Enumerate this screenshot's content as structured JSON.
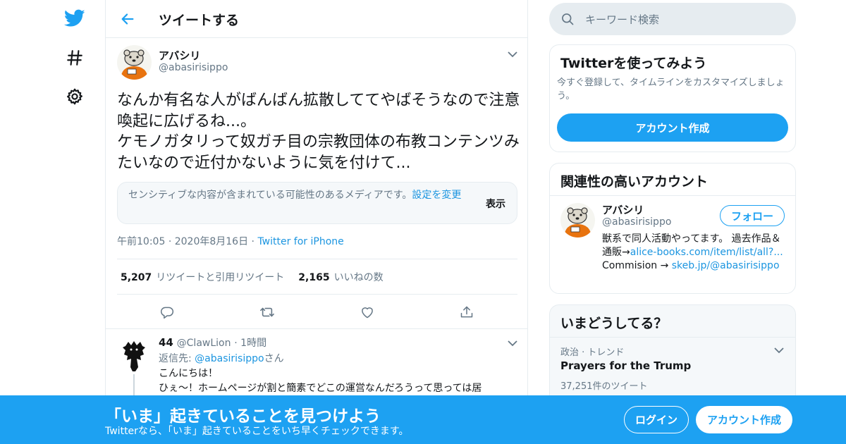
{
  "header": {
    "title": "ツイートする"
  },
  "tweet": {
    "name": "アバシリ",
    "handle": "@abasirisippo",
    "text": "なんか有名な人がばんばん拡散しててやばそうなので注意喚起に広げるね...。\nケモノガタリって奴ガチ目の宗教団体の布教コンテンツみたいなので近付かないように気を付けて...",
    "sensitive_text": "センシティブな内容が含まれている可能性のあるメディアです。",
    "sensitive_link": "設定を変更",
    "sensitive_show": "表示",
    "time": "午前10:05",
    "date": "2020年8月16日",
    "source": "Twitter for iPhone",
    "retweets_count": "5,207",
    "retweets_label": "リツイートと引用リツイート",
    "likes_count": "2,165",
    "likes_label": "いいねの数",
    "icons": [
      "reply-icon",
      "retweet-icon",
      "like-icon",
      "share-icon"
    ]
  },
  "reply": {
    "name": "44",
    "handle": "@ClawLion",
    "time": "1時間",
    "to_label": "返信先:",
    "to_handle": "@abasirisippo",
    "to_suffix": "さん",
    "line1": "こんにちは！",
    "line2": "ひぇ～！ホームページが割と簡素でどこの運営なんだろうって思っては居"
  },
  "search": {
    "placeholder": "キーワード検索"
  },
  "try_card": {
    "title": "Twitterを使ってみよう",
    "desc": "今すぐ登録して、タイムラインをカスタマイズしましょう。",
    "button": "アカウント作成"
  },
  "related_card": {
    "title": "関連性の高いアカウント",
    "name": "アバシリ",
    "handle": "@abasirisippo",
    "follow": "フォロー",
    "bio_prefix": "獣系で同人活動やってます。 過去作品＆通販→",
    "bio_link1": "alice-books.com/item/list/all?...",
    "bio_mid": " Commision → ",
    "bio_link2": "skeb.jp/@abasirisippo"
  },
  "trends_card": {
    "title": "いまどうしてる？",
    "category": "政治 · トレンド",
    "trend": "Prayers for the Trump",
    "count": "37,251件のツイート"
  },
  "bottom_bar": {
    "headline": "「いま」起きていることを見つけよう",
    "sub": "Twitterなら、「いま」起きていることをいち早くチェックできます。",
    "login": "ログイン",
    "signup": "アカウント作成"
  },
  "colors": {
    "brand": "#1da1f2",
    "link": "#1b95e0",
    "muted": "#657786",
    "border": "#e6ecf0"
  }
}
